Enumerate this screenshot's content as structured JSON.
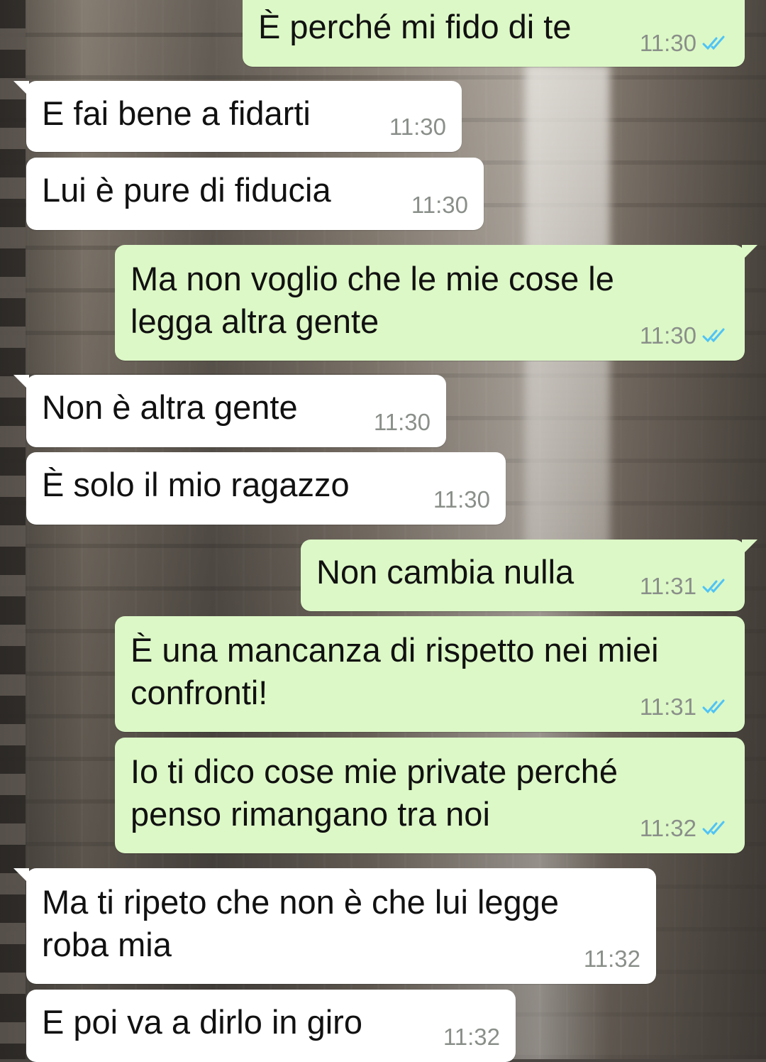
{
  "colors": {
    "outgoing_bubble": "#dcf8c6",
    "incoming_bubble": "#ffffff",
    "read_tick": "#4fc3f7",
    "timestamp": "#8a8f8a"
  },
  "messages": [
    {
      "direction": "out",
      "text": "È perché mi fido di te",
      "time": "11:30",
      "status_icon": "double-check-read-icon"
    },
    {
      "direction": "in",
      "text": "E fai bene a fidarti",
      "time": "11:30"
    },
    {
      "direction": "in",
      "text": "Lui è pure di fiducia",
      "time": "11:30"
    },
    {
      "direction": "out",
      "text": "Ma non voglio che le mie cose le legga altra gente",
      "time": "11:30",
      "status_icon": "double-check-read-icon"
    },
    {
      "direction": "in",
      "text": "Non è altra gente",
      "time": "11:30"
    },
    {
      "direction": "in",
      "text": "È solo il mio ragazzo",
      "time": "11:30"
    },
    {
      "direction": "out",
      "text": "Non cambia nulla",
      "time": "11:31",
      "status_icon": "double-check-read-icon"
    },
    {
      "direction": "out",
      "text": "È una mancanza di rispetto nei miei confronti!",
      "time": "11:31",
      "status_icon": "double-check-read-icon"
    },
    {
      "direction": "out",
      "text": "Io ti dico cose mie private perché penso rimangano tra noi",
      "time": "11:32",
      "status_icon": "double-check-read-icon"
    },
    {
      "direction": "in",
      "text": "Ma ti ripeto che non è che lui legge roba mia",
      "time": "11:32"
    },
    {
      "direction": "in",
      "text": "E poi va a dirlo in giro",
      "time": "11:32"
    }
  ]
}
